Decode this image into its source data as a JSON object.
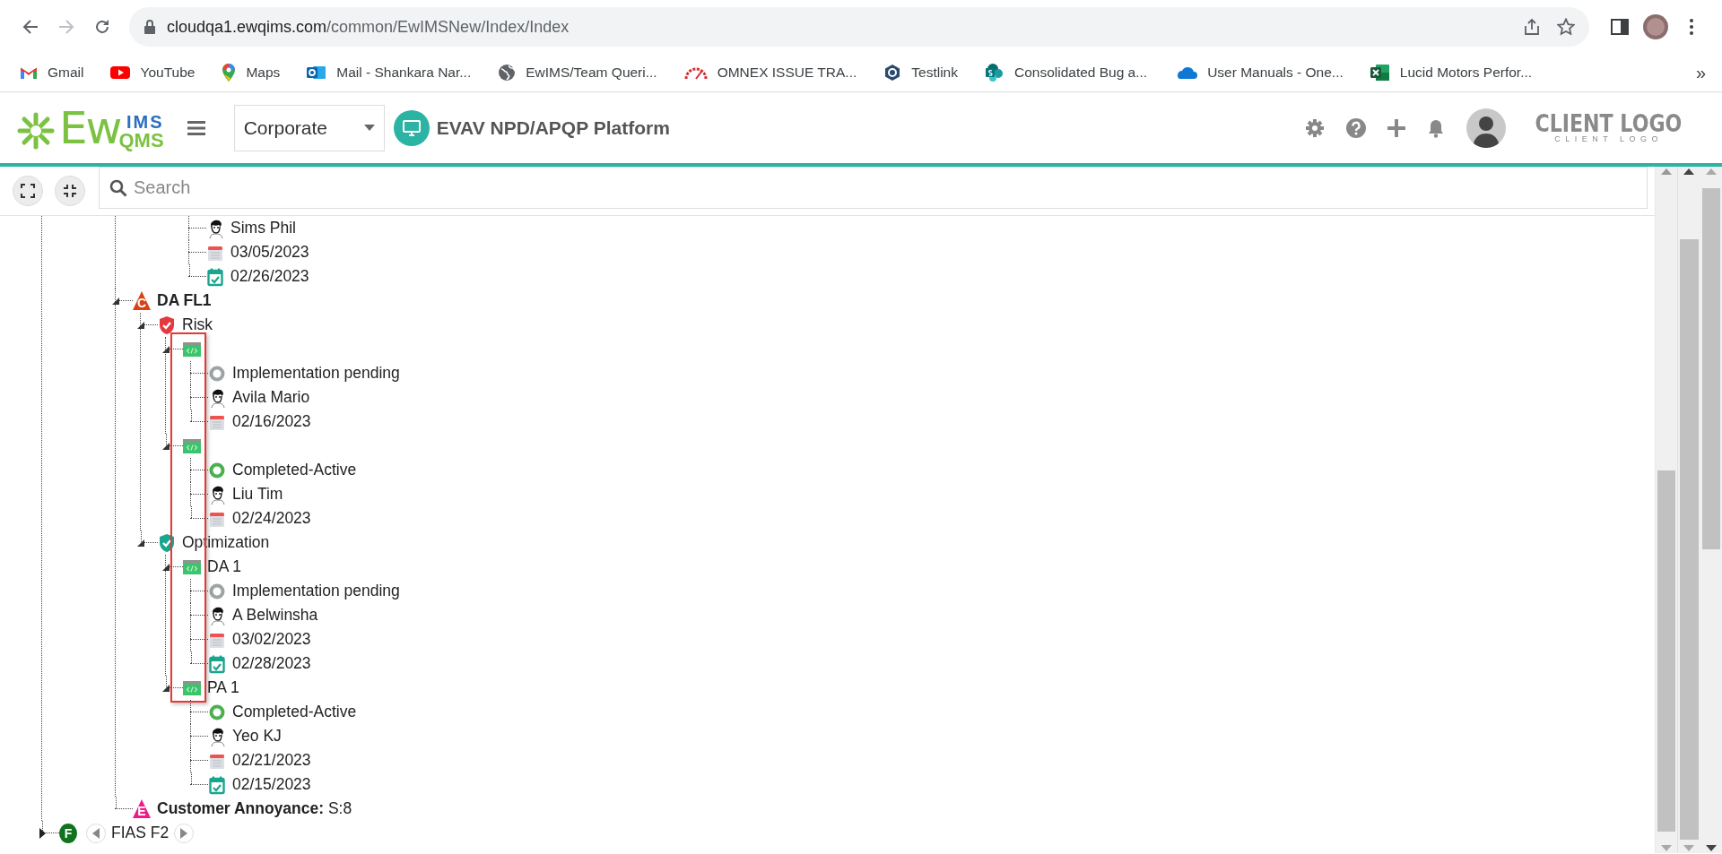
{
  "browser": {
    "url_host": "cloudqa1.ewqims.com",
    "url_path": "/common/EwIMSNew/Index/Index",
    "bookmarks": [
      {
        "kind": "gmail",
        "label": "Gmail"
      },
      {
        "kind": "youtube",
        "label": "YouTube"
      },
      {
        "kind": "maps",
        "label": "Maps"
      },
      {
        "kind": "outlook",
        "label": "Mail - Shankara Nar..."
      },
      {
        "kind": "globe",
        "label": "EwIMS/Team Queri..."
      },
      {
        "kind": "omnex",
        "label": "OMNEX ISSUE TRA..."
      },
      {
        "kind": "testlink",
        "label": "Testlink"
      },
      {
        "kind": "sharepoint",
        "label": "Consolidated Bug a..."
      },
      {
        "kind": "onedrive",
        "label": "User Manuals - One..."
      },
      {
        "kind": "excel",
        "label": "Lucid Motors Perfor..."
      }
    ],
    "more": "»"
  },
  "header": {
    "logo": {
      "main": "Ew",
      "top": "IMS",
      "bottom": "QMS"
    },
    "site_select": {
      "value": "Corporate"
    },
    "platform": "EVAV NPD/APQP Platform",
    "client_logo": {
      "title": "CLIENT LOGO",
      "subtitle": "CLIENT LOGO"
    }
  },
  "search": {
    "placeholder": "Search"
  },
  "tree": {
    "continued_leaves": [
      {
        "kind": "person",
        "text": "Sims Phil"
      },
      {
        "kind": "due-date",
        "text": "03/05/2023"
      },
      {
        "kind": "done-date",
        "text": "02/26/2023"
      }
    ],
    "nodes": [
      {
        "kind": "failure",
        "badge": "C",
        "color": "#d84315",
        "text": "DA FL1",
        "expanded": true,
        "children": [
          {
            "kind": "shield",
            "color": "#e53940",
            "text": "Risk",
            "expanded": true,
            "children": [
              {
                "kind": "action",
                "expanded": true,
                "children": [
                  {
                    "kind": "status",
                    "color": "#9ea3a3",
                    "text": "Implementation pending"
                  },
                  {
                    "kind": "person",
                    "text": "Avila Mario"
                  },
                  {
                    "kind": "due-date",
                    "text": "02/16/2023"
                  }
                ]
              },
              {
                "kind": "action",
                "expanded": true,
                "children": [
                  {
                    "kind": "status",
                    "color": "#4caf50",
                    "text": "Completed-Active"
                  },
                  {
                    "kind": "person",
                    "text": "Liu Tim"
                  },
                  {
                    "kind": "due-date",
                    "text": "02/24/2023"
                  }
                ]
              }
            ]
          },
          {
            "kind": "shield",
            "color": "#1aa58f",
            "text": "Optimization",
            "expanded": true,
            "children": [
              {
                "kind": "action",
                "text": "DA 1",
                "expanded": true,
                "children": [
                  {
                    "kind": "status",
                    "color": "#9ea3a3",
                    "text": "Implementation pending"
                  },
                  {
                    "kind": "person",
                    "text": "A Belwinsha"
                  },
                  {
                    "kind": "due-date",
                    "text": "03/02/2023"
                  },
                  {
                    "kind": "done-date",
                    "text": "02/28/2023"
                  }
                ]
              },
              {
                "kind": "action",
                "text": "PA 1",
                "expanded": true,
                "children": [
                  {
                    "kind": "status",
                    "color": "#4caf50",
                    "text": "Completed-Active"
                  },
                  {
                    "kind": "person",
                    "text": "Yeo KJ"
                  },
                  {
                    "kind": "due-date",
                    "text": "02/21/2023"
                  },
                  {
                    "kind": "done-date",
                    "text": "02/15/2023"
                  }
                ]
              }
            ]
          }
        ]
      },
      {
        "kind": "effect",
        "badge": "E",
        "color": "#ec1c8c",
        "text": "**Customer Annoyance:** S:8"
      }
    ],
    "root": {
      "kind": "function",
      "badge": "F",
      "color": "#12731f",
      "text": "FIAS F2",
      "expanded": false
    }
  }
}
